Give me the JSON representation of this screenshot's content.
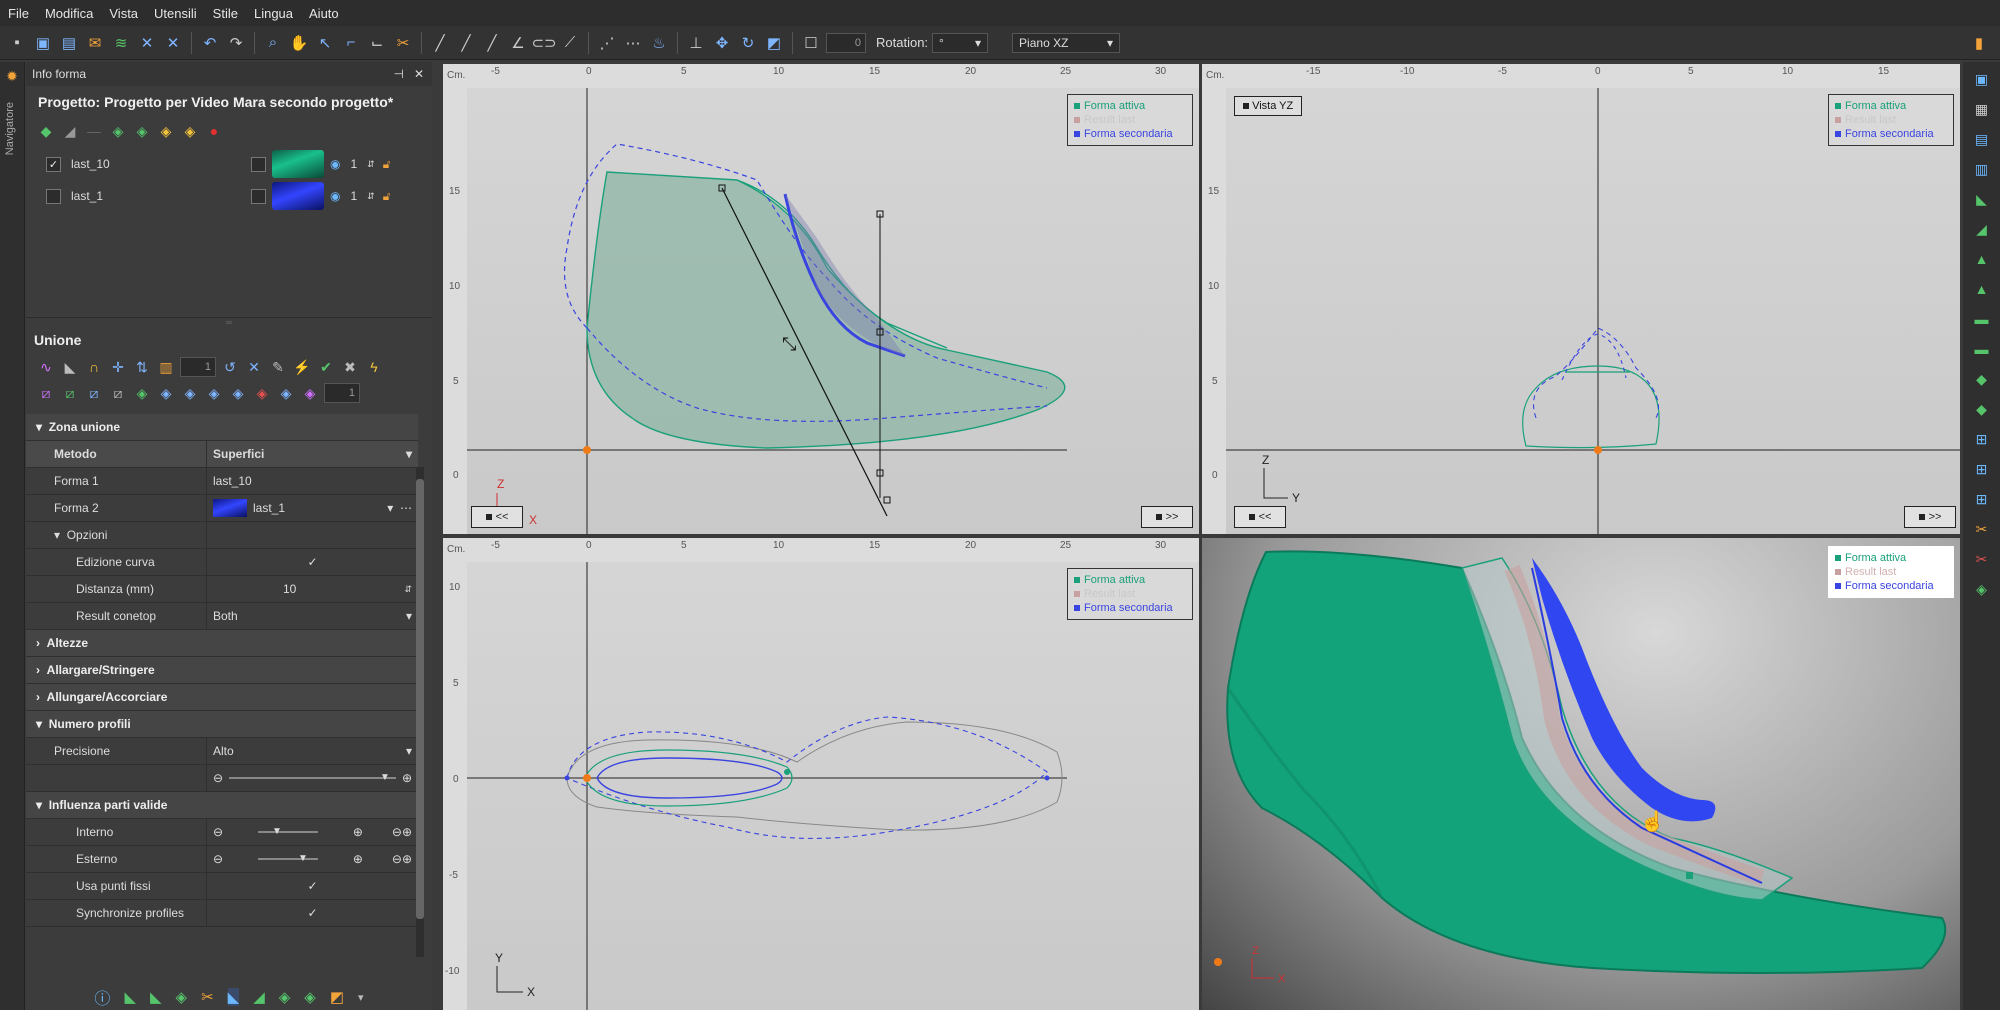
{
  "menu": [
    "File",
    "Modifica",
    "Vista",
    "Utensili",
    "Stile",
    "Lingua",
    "Aiuto"
  ],
  "toolbar": {
    "spin_value": "0",
    "rotation_label": "Rotation:",
    "rotation_value": "°",
    "plane_value": "Piano XZ"
  },
  "nav_strip_label": "Navigatore",
  "info_panel": {
    "title": "Info forma",
    "project": "Progetto: Progetto per Video Mara secondo progetto*",
    "shapes": [
      {
        "name": "last_10",
        "checked": "✓",
        "count": "1",
        "color": "#19a77d"
      },
      {
        "name": "last_1",
        "checked": "",
        "count": "1",
        "color": "#2a3cd8"
      }
    ]
  },
  "union_panel": {
    "title": "Unione",
    "spin1": "1",
    "spin2": "1",
    "zona_unione": "Zona unione",
    "metodo_label": "Metodo",
    "metodo_value": "Superfici",
    "forma1_label": "Forma 1",
    "forma1_value": "last_10",
    "forma2_label": "Forma 2",
    "forma2_value": "last_1",
    "opzioni": "Opzioni",
    "edizione_label": "Edizione curva",
    "edizione_value": "✓",
    "distanza_label": "Distanza (mm)",
    "distanza_value": "10",
    "result_label": "Result conetop",
    "result_value": "Both",
    "altezze": "Altezze",
    "allargare": "Allargare/Stringere",
    "allungare": "Allungare/Accorciare",
    "numero_profili": "Numero profili",
    "precisione_label": "Precisione",
    "precisione_value": "Alto",
    "influenza": "Influenza parti valide",
    "interno_label": "Interno",
    "esterno_label": "Esterno",
    "usa_label": "Usa punti fissi",
    "usa_value": "✓",
    "sync_label": "Synchronize profiles",
    "sync_value": "✓"
  },
  "viewports": {
    "unit": "Cm.",
    "legend": {
      "active": "Forma attiva",
      "result": "Result last",
      "secondary": "Forma secondaria"
    },
    "nav_prev": "<<",
    "nav_next": ">>",
    "yz_label": "Vista YZ",
    "ruler_x_xz": [
      "-5",
      "0",
      "5",
      "10",
      "15",
      "20",
      "25",
      "30"
    ],
    "ruler_y_xz": [
      "15",
      "10",
      "5",
      "0"
    ],
    "ruler_x_yz": [
      "-15",
      "-10",
      "-5",
      "0",
      "5",
      "10",
      "15"
    ],
    "ruler_y_yz": [
      "15",
      "10",
      "5",
      "0"
    ],
    "ruler_y_xy": [
      "10",
      "5",
      "0",
      "-5",
      "-10"
    ],
    "axes": {
      "z": "Z",
      "x": "X",
      "y": "Y"
    }
  },
  "colors": {
    "active": "#1aa07a",
    "secondary": "#3a44e0",
    "result": "#c8a0a0",
    "origin": "#f07a18"
  }
}
